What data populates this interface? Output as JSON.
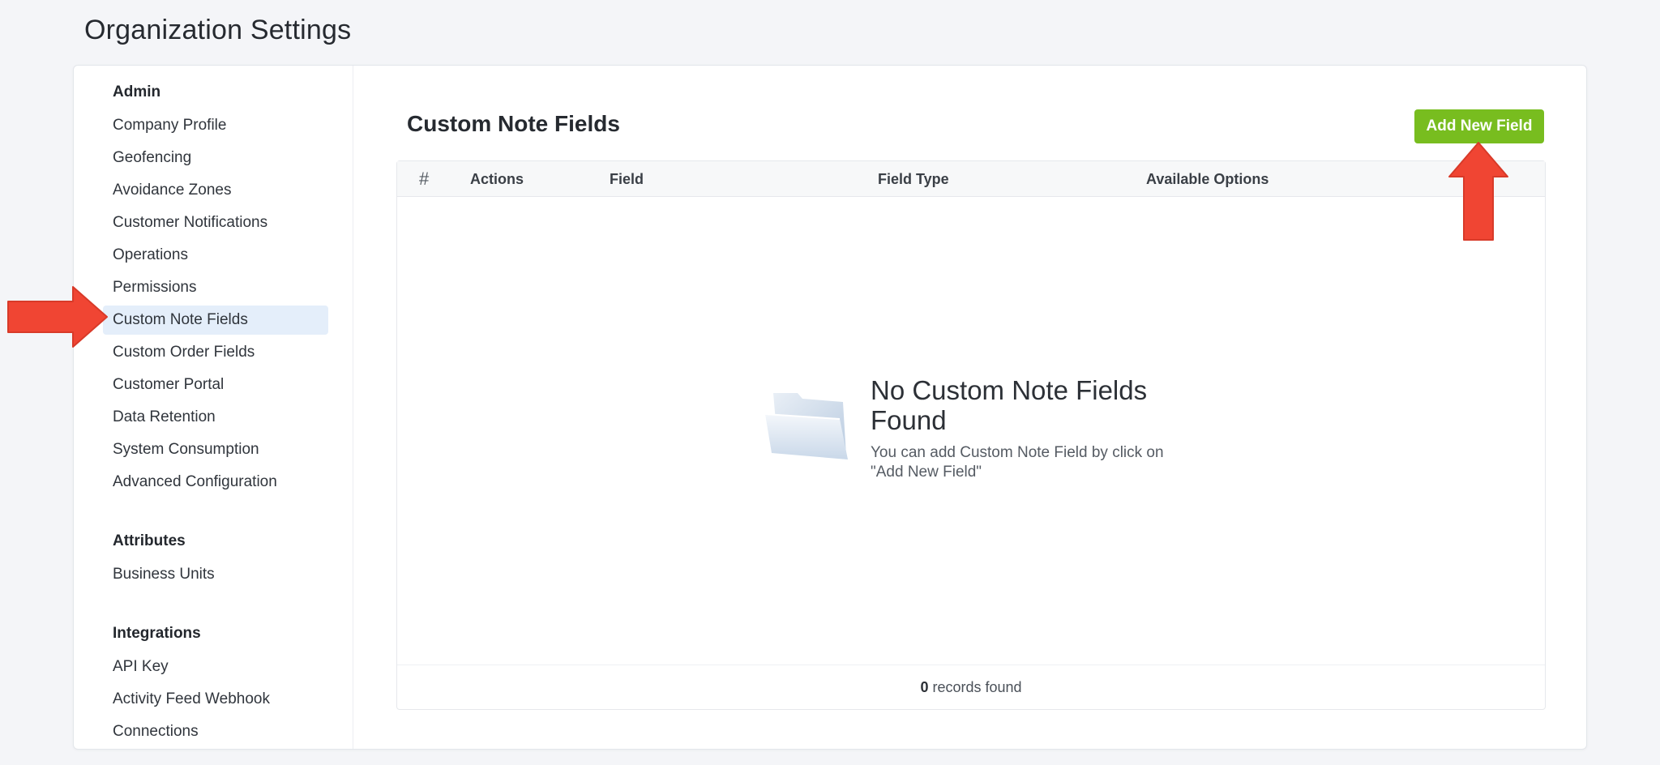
{
  "page": {
    "title": "Organization Settings"
  },
  "sidebar": {
    "groups": [
      {
        "title": "Admin",
        "items": [
          "Company Profile",
          "Geofencing",
          "Avoidance Zones",
          "Customer Notifications",
          "Operations",
          "Permissions",
          "Custom Note Fields",
          "Custom Order Fields",
          "Customer Portal",
          "Data Retention",
          "System Consumption",
          "Advanced Configuration"
        ]
      },
      {
        "title": "Attributes",
        "items": [
          "Business Units"
        ]
      },
      {
        "title": "Integrations",
        "items": [
          "API Key",
          "Activity Feed Webhook",
          "Connections"
        ]
      }
    ],
    "active_item": "Custom Note Fields"
  },
  "main": {
    "title": "Custom Note Fields",
    "add_button_label": "Add New Field",
    "table": {
      "columns": [
        "#",
        "Actions",
        "Field",
        "Field Type",
        "Available Options"
      ],
      "rows": []
    },
    "empty_state": {
      "icon": "folder-icon",
      "title": "No Custom Note Fields Found",
      "description": "You can add Custom Note Field by click on \"Add New Field\""
    },
    "footer": {
      "count": "0",
      "suffix": "records found"
    }
  },
  "annotations": {
    "arrow_color": "#f04533"
  }
}
